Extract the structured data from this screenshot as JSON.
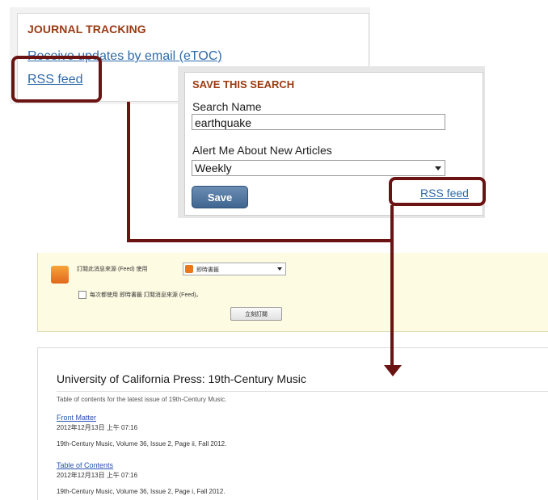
{
  "journal_tracking": {
    "title": "JOURNAL TRACKING",
    "email_link": "Receive updates by email (eTOC)",
    "rss_link": "RSS feed"
  },
  "save_search": {
    "title": "SAVE THIS SEARCH",
    "search_name_label": "Search Name",
    "search_name_value": "earthquake",
    "alert_label": "Alert Me About New Articles",
    "alert_value": "Weekly",
    "save_label": "Save",
    "rss_link": "RSS feed"
  },
  "feed_subscribe": {
    "subscribe_text": "訂閱此消息來源 (Feed) 使用",
    "reader_value": "即時書籤",
    "always_text": "每次都使用 即時書籤 訂閱消息來源 (Feed)。",
    "subscribe_button": "立刻訂閱"
  },
  "feed": {
    "title": "University of California Press: 19th-Century Music",
    "subtitle": "Table of contents for the latest issue of 19th-Century Music.",
    "items": [
      {
        "title": "Front Matter",
        "date": "2012年12月13日 上午 07:16",
        "desc": "19th-Century Music, Volume 36, Issue 2, Page ii, Fall 2012."
      },
      {
        "title": "Table of Contents",
        "date": "2012年12月13日 上午 07:16",
        "desc": "19th-Century Music, Volume 36, Issue 2, Page i, Fall 2012."
      }
    ]
  },
  "colors": {
    "highlight": "#6b1212",
    "heading": "#9a3a12",
    "link": "#2f6aa8"
  },
  "icons": [
    "rss-icon",
    "chevron-down-icon",
    "arrow-down-icon"
  ]
}
